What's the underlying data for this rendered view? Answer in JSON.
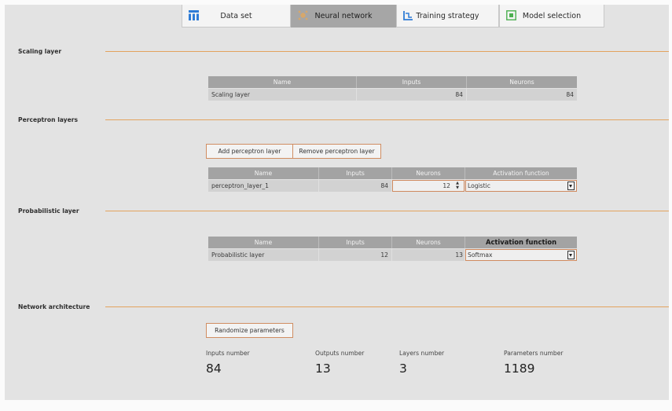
{
  "tabs": [
    {
      "label": "Data set",
      "icon": "data-set-icon",
      "active": false
    },
    {
      "label": "Neural network",
      "icon": "neural-network-icon",
      "active": true
    },
    {
      "label": "Training strategy",
      "icon": "training-strategy-icon",
      "active": false
    },
    {
      "label": "Model selection",
      "icon": "model-selection-icon",
      "active": false
    }
  ],
  "colors": {
    "accent": "#e3a35e",
    "button_border": "#d08d62",
    "header_bg": "#a3a3a3",
    "row_bg": "#d2d2d2",
    "icon_blue": "#2f7cd6",
    "icon_green": "#4caf50"
  },
  "scaling": {
    "title": "Scaling layer",
    "headers": [
      "Name",
      "Inputs",
      "Neurons"
    ],
    "row": {
      "name": "Scaling layer",
      "inputs": "84",
      "neurons": "84"
    }
  },
  "perceptron": {
    "title": "Perceptron layers",
    "add_label": "Add perceptron layer",
    "remove_label": "Remove perceptron layer",
    "headers": [
      "Name",
      "Inputs",
      "Neurons",
      "Activation function"
    ],
    "row": {
      "name": "perceptron_layer_1",
      "inputs": "84",
      "neurons": "12",
      "activation": "Logistic"
    }
  },
  "probabilistic": {
    "title": "Probabilistic layer",
    "headers": [
      "Name",
      "Inputs",
      "Neurons",
      "Activation function"
    ],
    "row": {
      "name": "Probabilistic layer",
      "inputs": "12",
      "neurons": "13",
      "activation": "Softmax"
    }
  },
  "architecture": {
    "title": "Network architecture",
    "randomize_label": "Randomize parameters",
    "stats": [
      {
        "label": "Inputs number",
        "value": "84"
      },
      {
        "label": "Outputs number",
        "value": "13"
      },
      {
        "label": "Layers number",
        "value": "3"
      },
      {
        "label": "Parameters number",
        "value": "1189"
      }
    ]
  }
}
